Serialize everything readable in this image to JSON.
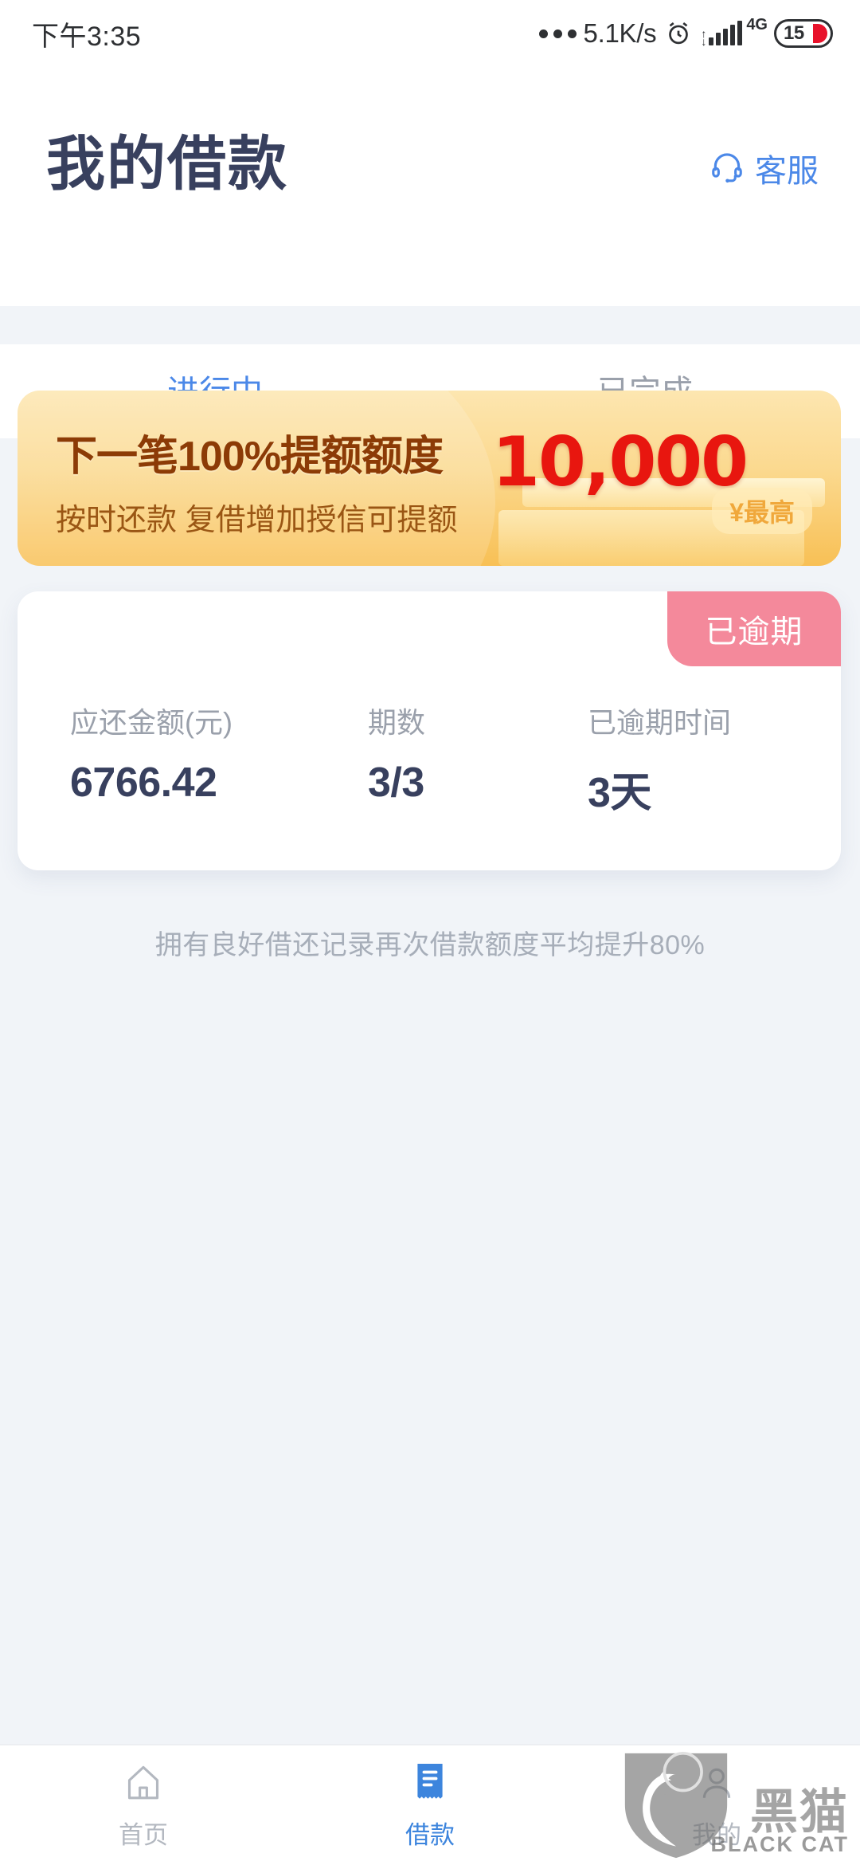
{
  "status_bar": {
    "time": "下午3:35",
    "network_speed": "5.1K/s",
    "network_type": "4G",
    "battery_level": "15",
    "icons": [
      "more-dots-icon",
      "alarm-clock-icon",
      "signal-bars-icon",
      "battery-icon"
    ]
  },
  "header": {
    "title": "我的借款",
    "support_label": "客服",
    "support_icon": "headset-icon"
  },
  "tabs": [
    {
      "label": "进行中",
      "active": true
    },
    {
      "label": "已完成",
      "active": false
    }
  ],
  "banner": {
    "headline": "下一笔100%提额额度",
    "subline": "按时还款  复借增加授信可提额",
    "amount": "10,000",
    "max_badge": "¥最高",
    "amount_color": "#e8160f",
    "text_color": "#8c3b06"
  },
  "loan_card": {
    "status_badge": "已逾期",
    "status_badge_color": "#f4899b",
    "metrics": [
      {
        "label": "应还金额(元)",
        "value": "6766.42"
      },
      {
        "label": "期数",
        "value": "3/3"
      },
      {
        "label": "已逾期时间",
        "value": "3天"
      }
    ]
  },
  "hint": "拥有良好借还记录再次借款额度平均提升80%",
  "bottom_nav": [
    {
      "label": "首页",
      "icon": "home-icon",
      "active": false
    },
    {
      "label": "借款",
      "icon": "receipt-icon",
      "active": true
    },
    {
      "label": "我的",
      "icon": "person-icon",
      "active": false
    }
  ],
  "watermark": {
    "title": "黑猫",
    "subtitle": "BLACK CAT",
    "logo_icon": "black-cat-shield-icon"
  },
  "theme": {
    "page_background": "#f1f4f8",
    "accent_blue": "#3d85dd",
    "title_navy": "#38405e",
    "muted_gray": "#9aa0ab"
  }
}
